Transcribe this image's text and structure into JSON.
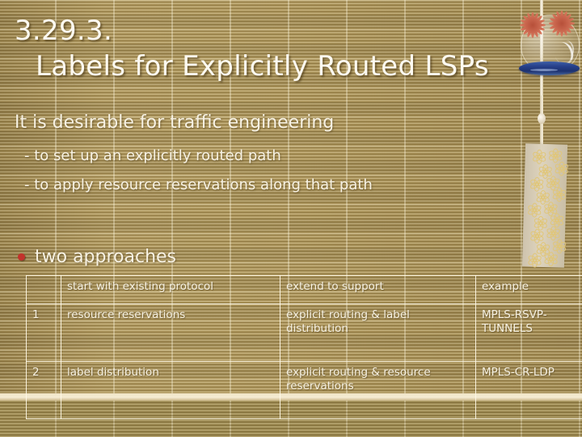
{
  "slide": {
    "title_number": "3.29.3.",
    "title_text": "Labels for Explicitly Routed LSPs",
    "lead_line": "It is desirable for traffic engineering",
    "sub_lines": [
      "- to set up an explicitly routed path",
      "- to apply resource reservations along that path"
    ],
    "bullet_label": "two approaches",
    "bullet_color": "#c2332c",
    "text_color": "#f7f2e4",
    "background_color": "#a89055"
  },
  "decoration": {
    "name": "japanese-wind-chime",
    "bell_band_color": "#27408a",
    "flower_color": "#b7503a",
    "paper_strip_color": "#d4c9b2"
  },
  "table": {
    "headers": [
      "",
      "start with existing protocol",
      "extend to support",
      "example"
    ],
    "rows": [
      {
        "num": "1",
        "start": "resource reservations",
        "extend": "explicit routing & label distribution",
        "example": "MPLS-RSVP-TUNNELS"
      },
      {
        "num": "2",
        "start": "label distribution",
        "extend": "explicit routing & resource reservations",
        "example": "MPLS-CR-LDP"
      }
    ]
  }
}
